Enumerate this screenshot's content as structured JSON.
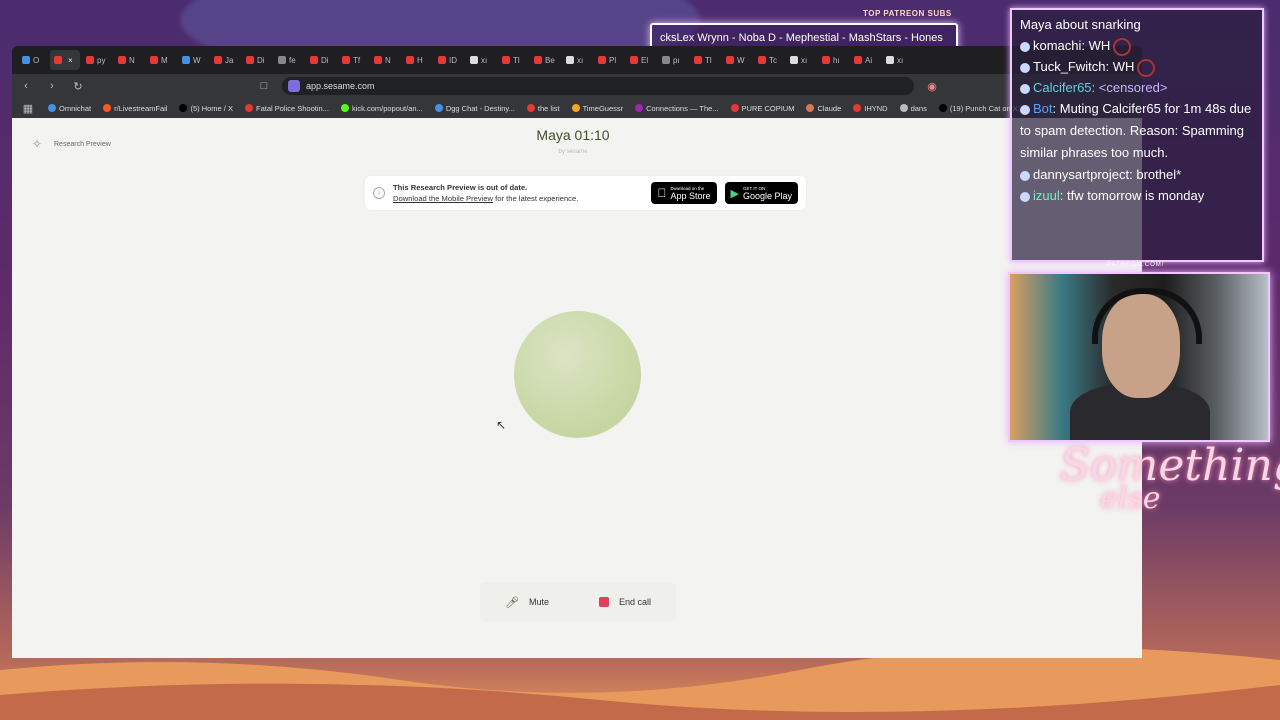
{
  "overlay": {
    "top_patreon_label": "TOP PATREON SUBS",
    "ticker_text": "cksLex Wrynn -  Noba D - Mephestial - MashStars - Hones",
    "patreon_url": "PATREON.COM/",
    "signature_line1": "Something",
    "signature_line2": "else",
    "chat": [
      {
        "user": "Maya about snarking",
        "text": ""
      },
      {
        "user": "komachi",
        "text": ": WH"
      },
      {
        "user": "Tuck_Fwitch",
        "text": ": WH"
      },
      {
        "user": "Calcifer65",
        "text": ": <censored>"
      },
      {
        "user": "Bot",
        "text": ": Muting Calcifer65 for 1m 48s due to spam detection. Reason: Spamming similar phrases too much."
      },
      {
        "user": "dannysartproject",
        "text": ": brothel*"
      },
      {
        "user": "izuul",
        "text": ": tfw tomorrow is monday"
      }
    ]
  },
  "browser": {
    "tabs": [
      "O",
      "",
      "py",
      "N",
      "M",
      "W",
      "Ja",
      "Di",
      "fe",
      "Di",
      "Tf",
      "N",
      "H",
      "ID",
      "xı",
      "Tl",
      "Be",
      "xı",
      "Pl",
      "El",
      "pı",
      "Tl",
      "W",
      "Tc",
      "xı",
      "hı",
      "Ai",
      "xı"
    ],
    "url": "app.sesame.com",
    "bookmarks": [
      "Omnichat",
      "r/LivestreamFail",
      "(5) Home / X",
      "Fatal Police Shootin...",
      "kick.com/popout/an...",
      "Dgg Chat - Destiny...",
      "the list",
      "TimeGuessr",
      "Connections — The...",
      "PURE COPIUM",
      "Claude",
      "IHYND",
      "dans",
      "(19) Punch Cat on X:..."
    ]
  },
  "page": {
    "research_preview_label": "Research Preview",
    "title": "Maya 01:10",
    "subtitle": "by sesame",
    "banner": {
      "headline": "This Research Preview is out of date.",
      "link_text": "Download the Mobile Preview",
      "tail_text": " for the latest experience.",
      "app_store_small": "Download on the",
      "app_store_big": "App Store",
      "google_play_small": "GET IT ON",
      "google_play_big": "Google Play"
    },
    "controls": {
      "mute_label": "Mute",
      "end_call_label": "End call"
    }
  },
  "colors": {
    "orb": "#c9d8a6",
    "end_call": "#e0405a",
    "title": "#3f4f2a"
  }
}
